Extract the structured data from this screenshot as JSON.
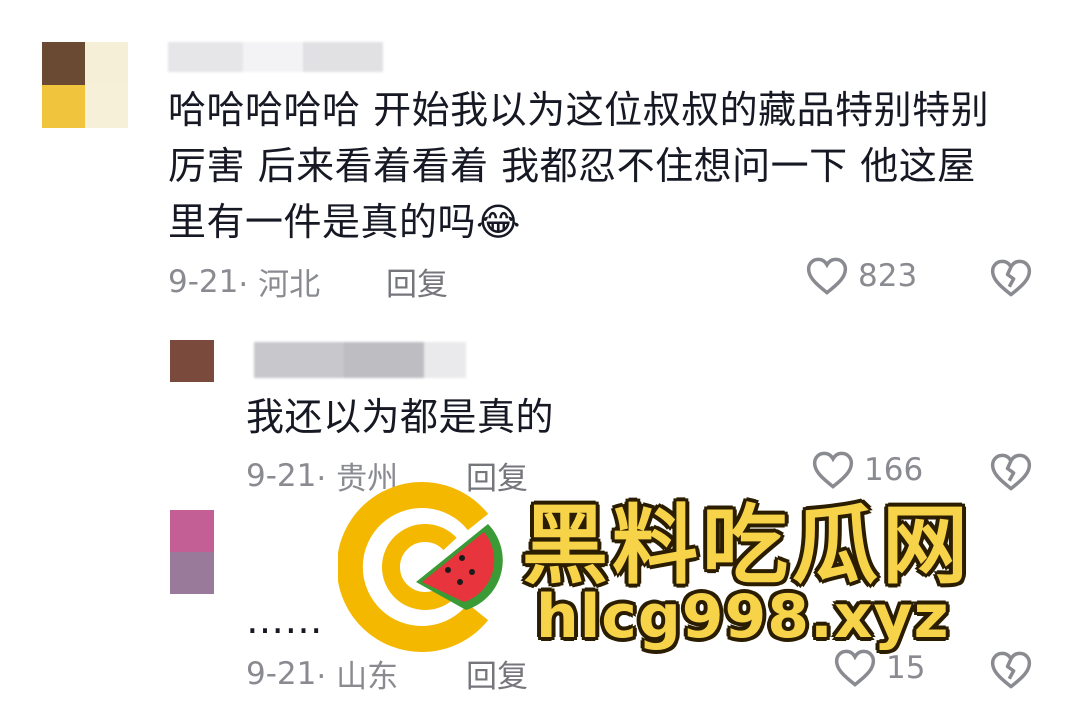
{
  "comments": [
    {
      "text_lines": [
        "哈哈哈哈哈 开始我以为这位叔叔的藏品特别特别",
        "厉害 后来看着看着 我都忍不住想问一下 他这屋",
        "里有一件是真的吗"
      ],
      "emoji": "😂",
      "date": "9-21",
      "location": "· 河北",
      "reply_label": "回复",
      "likes": "823"
    },
    {
      "text_lines": [
        "我还以为都是真的"
      ],
      "date": "9-21",
      "location": "· 贵州",
      "reply_label": "回复",
      "likes": "166"
    },
    {
      "text_lines": [
        "……"
      ],
      "date": "9-21",
      "location": "· 山东",
      "reply_label": "回复",
      "likes": "15"
    }
  ],
  "watermark": {
    "title": "黑料吃瓜网",
    "url": "hlcg998.xyz"
  },
  "colors": {
    "text": "#161823",
    "meta": "#8a8b91",
    "watermark_yellow": "#f7d34a",
    "watermark_outline": "#2b1d00",
    "watermelon_green": "#3a9a35",
    "watermelon_red": "#e8343c"
  },
  "icons": {
    "like": "heart-outline-icon",
    "dislike": "broken-heart-icon"
  }
}
